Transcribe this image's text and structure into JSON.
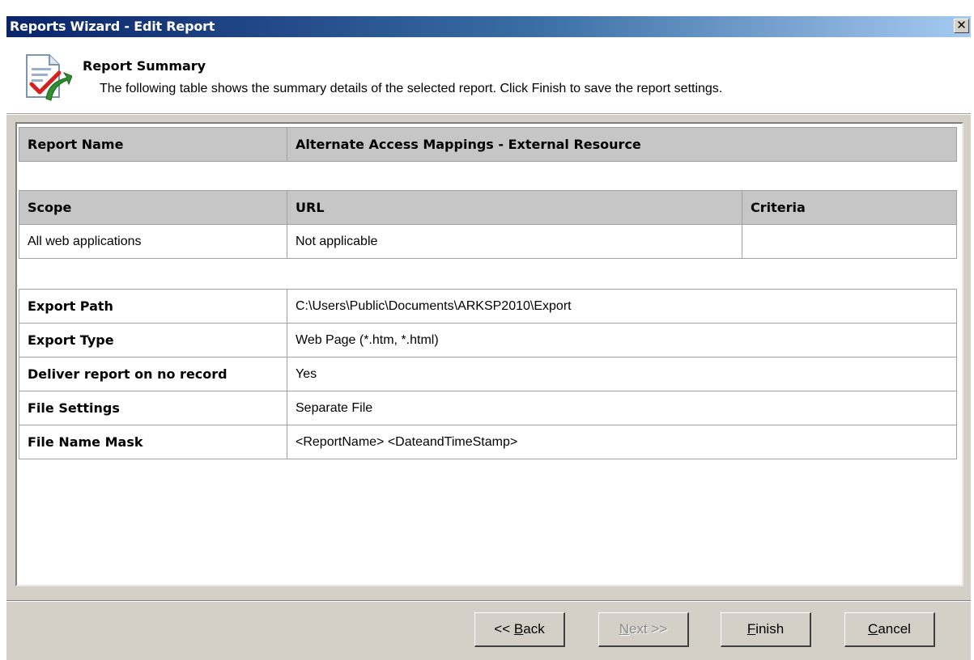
{
  "window": {
    "title": "Reports Wizard - Edit Report",
    "close_glyph": "✕"
  },
  "header": {
    "title": "Report Summary",
    "description": "The following table shows the summary details of the selected report. Click Finish to save the report settings."
  },
  "report_name": {
    "label": "Report Name",
    "value": "Alternate Access Mappings - External Resource"
  },
  "scope_table": {
    "columns": [
      "Scope",
      "URL",
      "Criteria"
    ],
    "rows": [
      [
        "All web applications",
        "Not applicable",
        ""
      ]
    ]
  },
  "details": [
    {
      "label": "Export Path",
      "value": "C:\\Users\\Public\\Documents\\ARKSP2010\\Export"
    },
    {
      "label": "Export Type",
      "value": "Web Page (*.htm, *.html)"
    },
    {
      "label": "Deliver report on no record",
      "value": "Yes"
    },
    {
      "label": "File Settings",
      "value": "Separate File"
    },
    {
      "label": "File Name Mask",
      "value": "<ReportName> <DateandTimeStamp>"
    }
  ],
  "buttons": {
    "back": {
      "prefix": "<< ",
      "mnemonic": "B",
      "rest": "ack"
    },
    "next": {
      "mnemonic": "N",
      "rest": "ext >>"
    },
    "finish": {
      "mnemonic": "F",
      "rest": "inish"
    },
    "cancel": {
      "mnemonic": "C",
      "rest": "ancel"
    }
  },
  "icons": {
    "header": "report-summary-icon"
  }
}
